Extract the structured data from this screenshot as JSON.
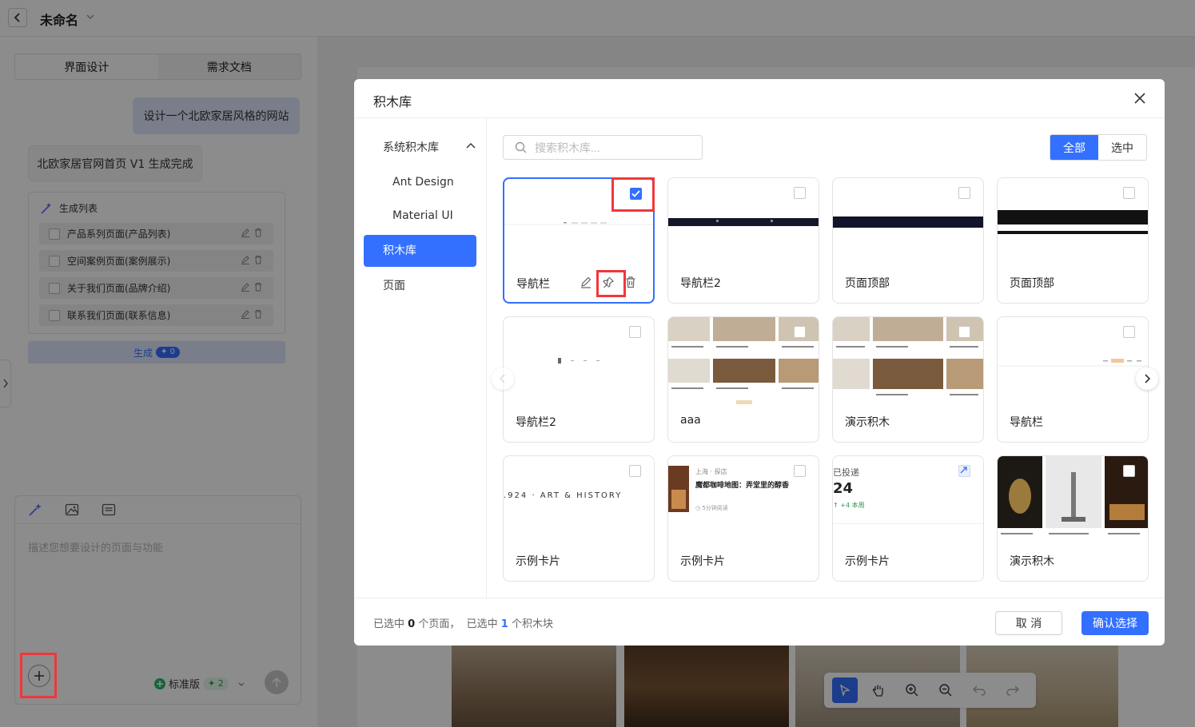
{
  "app": {
    "title": "未命名"
  },
  "left_panel": {
    "tabs": [
      {
        "label": "界面设计"
      },
      {
        "label": "需求文档"
      }
    ],
    "user_message": "设计一个北欧家居风格的网站",
    "bot_message": "北欧家居官网首页 V1 生成完成",
    "gen_list": {
      "title": "生成列表",
      "items": [
        {
          "label": "产品系列页面(产品列表)"
        },
        {
          "label": "空间案例页面(案例展示)"
        },
        {
          "label": "关于我们页面(品牌介绍)"
        },
        {
          "label": "联系我们页面(联系信息)"
        }
      ]
    },
    "generate_button": {
      "label": "生成",
      "badge": "0"
    },
    "composer": {
      "placeholder": "描述您想要设计的页面与功能",
      "plan_label": "标准版",
      "plan_badge": "2"
    }
  },
  "modal": {
    "title": "积木库",
    "sidebar": {
      "group_label": "系统积木库",
      "group_items": [
        {
          "label": "Ant Design"
        },
        {
          "label": "Material UI"
        }
      ],
      "active_item": "积木库",
      "other_item": "页面"
    },
    "search": {
      "placeholder": "搜索积木库..."
    },
    "filter": {
      "all_label": "全部",
      "selected_label": "选中"
    },
    "cards": [
      {
        "label": "导航栏",
        "checked": true
      },
      {
        "label": "导航栏2",
        "checked": false
      },
      {
        "label": "页面顶部",
        "checked": false
      },
      {
        "label": "页面顶部",
        "checked": false
      },
      {
        "label": "导航栏2",
        "checked": false
      },
      {
        "label": "aaa",
        "checked": false
      },
      {
        "label": "演示积木",
        "checked": false
      },
      {
        "label": "导航栏",
        "checked": false
      },
      {
        "label": "示例卡片",
        "checked": false
      },
      {
        "label": "示例卡片",
        "checked": false
      },
      {
        "label": "示例卡片",
        "checked": false
      },
      {
        "label": "演示积木",
        "checked": false
      }
    ],
    "thumb_texts": {
      "art_history": ".924 · ART & HISTORY",
      "cafe_tag": "上海 · 探店",
      "cafe_title": "魔都咖啡地图：弄堂里的醇香",
      "cafe_meta": "5分钟阅读",
      "stat_label": "已投递",
      "stat_value": "24",
      "stat_delta": "+4 本周"
    },
    "footer": {
      "prefix": "已选中",
      "pages_count": "0",
      "pages_suffix": "个页面，",
      "blocks_prefix": "已选中",
      "blocks_count": "1",
      "blocks_suffix": "个积木块",
      "cancel_label": "取 消",
      "confirm_label": "确认选择"
    }
  },
  "colors": {
    "accent": "#3370ff",
    "highlight": "#f0373b"
  }
}
